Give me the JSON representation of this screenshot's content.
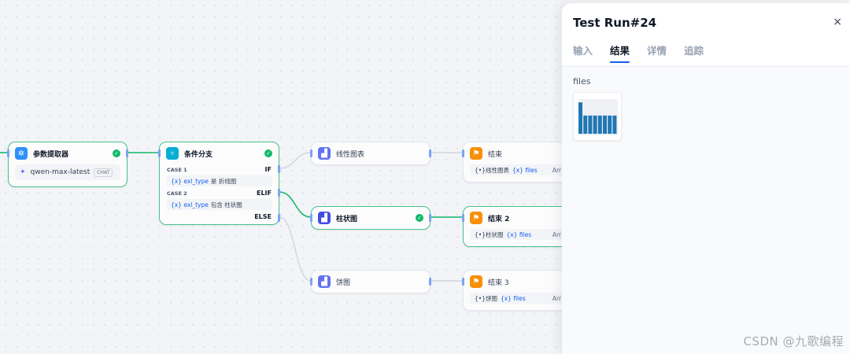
{
  "nodes": {
    "param_extractor": {
      "title": "参数提取器",
      "model": "qwen-max-latest",
      "model_tag": "CHAT"
    },
    "if_else": {
      "title": "条件分支",
      "case1_label": "CASE 1",
      "case1_kw": "IF",
      "case1_var": "{x}  exl_type",
      "case1_cond": "是 折线图",
      "case2_label": "CASE 2",
      "case2_kw": "ELIF",
      "case2_var": "{x}  exl_type",
      "case2_cond": "包含 柱状图",
      "else_kw": "ELSE"
    },
    "line_chart": {
      "title": "线性图表"
    },
    "bar_chart": {
      "title": "柱状图"
    },
    "pie_chart": {
      "title": "饼图"
    },
    "end1": {
      "title": "结束",
      "out_src": "{•}线性图表",
      "out_var": "{x} files",
      "out_type": "Arr"
    },
    "end2": {
      "title": "结束 2",
      "out_src": "{•}柱状图",
      "out_var": "{x} files",
      "out_type": "Arr"
    },
    "end3": {
      "title": "结束 3",
      "out_src": "{•}饼图",
      "out_var": "{x} files",
      "out_type": "Arr"
    }
  },
  "panel": {
    "title": "Test Run#24",
    "close": "×",
    "tabs": [
      "输入",
      "结果",
      "详情",
      "追踪"
    ],
    "active_tab": 1,
    "files_label": "files",
    "thumbnail_bars": [
      0.95,
      0.55,
      0.55,
      0.55,
      0.55,
      0.55,
      0.55,
      0.55
    ]
  },
  "colors": {
    "edge_active": "#12b76a",
    "edge_inactive": "#d0d5dd",
    "port": "#7da3f7",
    "bar_blue": "#1f77b4"
  },
  "icons": {
    "param_extractor": "gear-icon",
    "if_else": "branch-icon",
    "chart_tool": "chart-icon",
    "end": "flag-icon",
    "check": "check-icon"
  },
  "watermark": "CSDN @九歌编程"
}
